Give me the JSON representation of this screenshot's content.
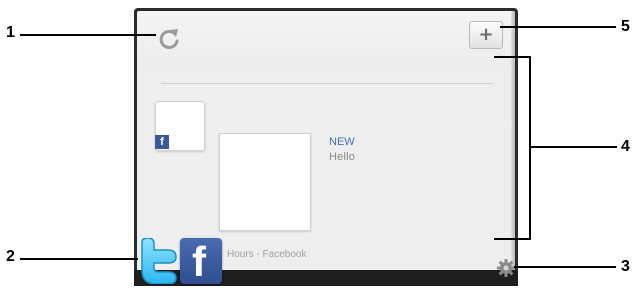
{
  "widget": {
    "add_label": "+",
    "post": {
      "status_label": "NEW",
      "text": "Hello",
      "time_text": "Hours - Facebook"
    },
    "icons": {
      "refresh": "refresh-icon",
      "twitter": "twitter-icon",
      "facebook": "facebook-icon",
      "facebook_letter": "f",
      "settings": "gear-icon"
    }
  },
  "callouts": [
    {
      "number": "1"
    },
    {
      "number": "2"
    },
    {
      "number": "3"
    },
    {
      "number": "4"
    },
    {
      "number": "5"
    }
  ],
  "colors": {
    "frame": "#2b2b2b",
    "panel": "#eeeeee",
    "facebook_blue": "#3b5998",
    "twitter_blue": "#33ccff",
    "status_blue": "#3e6fb3"
  }
}
